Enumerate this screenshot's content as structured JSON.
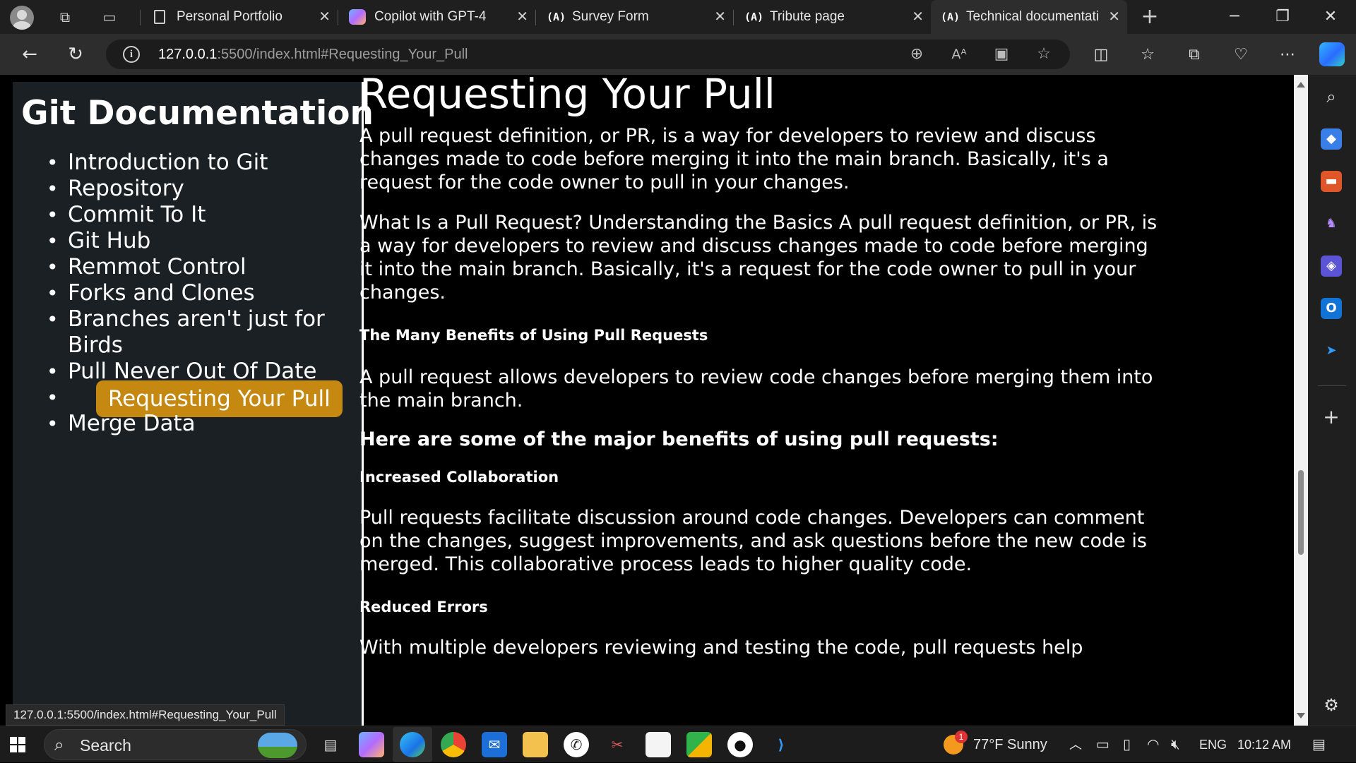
{
  "browser": {
    "tabs": [
      {
        "title": "Personal Portfolio",
        "icon": "page-icon"
      },
      {
        "title": "Copilot with GPT-4",
        "icon": "copilot-icon"
      },
      {
        "title": "Survey Form",
        "icon": "freecodecamp-icon",
        "fav_text": "(A)"
      },
      {
        "title": "Tribute page",
        "icon": "freecodecamp-icon",
        "fav_text": "(A)"
      },
      {
        "title": "Technical documentati",
        "icon": "freecodecamp-icon",
        "fav_text": "(A)"
      }
    ],
    "url": {
      "host": "127.0.0.1",
      "rest": ":5500/index.html#Requesting_Your_Pull"
    },
    "status_link": "127.0.0.1:5500/index.html#Requesting_Your_Pull"
  },
  "sidebar": {
    "title": "Git Documentation",
    "items": [
      "Introduction to Git",
      "Repository",
      "Commit To It",
      "Git Hub",
      "Remmot Control",
      "Forks and Clones",
      "Branches aren't just for Birds",
      "Pull Never Out Of Date",
      "Requesting Your Pull",
      "Merge Data"
    ],
    "active_index": 8,
    "highlight_color": "#c58912"
  },
  "main": {
    "heading": "Requesting Your Pull",
    "p1": "A pull request definition, or PR, is a way for developers to review and discuss changes made to code before merging it into the main branch. Basically, it's a request for the code owner to pull in your changes.",
    "p2": "What Is a Pull Request? Understanding the Basics A pull request definition, or PR, is a way for developers to review and discuss changes made to code before merging it into the main branch. Basically, it's a request for the code owner to pull in your changes.",
    "h_benefits": "The Many Benefits of Using Pull Requests",
    "p3": "A pull request allows developers to review code changes before merging them into the main branch.",
    "h_major": "Here are some of the major benefits of using pull requests:",
    "h_collab": "Increased Collaboration",
    "p4": "Pull requests facilitate discussion around code changes. Developers can comment on the changes, suggest improvements, and ask questions before the new code is merged. This collaborative process leads to higher quality code.",
    "h_errors": "Reduced Errors",
    "p5": "With multiple developers reviewing and testing the code, pull requests help"
  },
  "taskbar": {
    "search_label": "Search",
    "weather": "77°F  Sunny",
    "weather_badge": "1",
    "language": "ENG",
    "time": "10:12 AM"
  }
}
